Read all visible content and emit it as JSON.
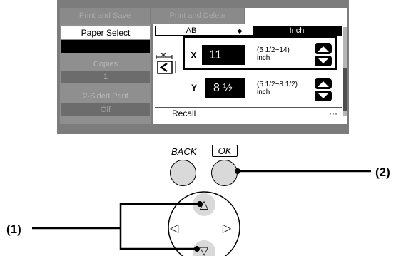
{
  "tabs": [
    "Print and Save",
    "Print and Delete",
    ""
  ],
  "left_panel": {
    "paper_select": "Paper Select",
    "copies_label": "Copies",
    "copies_value": "1",
    "duplex_label": "2-Sided Print",
    "duplex_value": "Off"
  },
  "unit_selector": {
    "ab": "AB",
    "arrows": "◆",
    "inch": "Inch"
  },
  "size_fields": {
    "x": {
      "label": "X",
      "value": "11",
      "range": "(5 1/2~14)",
      "unit": "inch"
    },
    "y": {
      "label": "Y",
      "value": "8 ½",
      "range": "(5 1/2~8 1/2)",
      "unit": "inch"
    }
  },
  "recall": {
    "label": "Recall",
    "more": "···"
  },
  "keys": {
    "back": "BACK",
    "ok": "OK"
  },
  "dpad": {
    "up": "△",
    "left": "◁",
    "right": "▷",
    "down": "▽"
  },
  "callouts": {
    "one": "(1)",
    "two": "(2)"
  },
  "colors": {
    "panel": "#7c7c7c",
    "key_fill": "#d9d9d9",
    "screen_bg": "#ffffff",
    "selected": "#000000"
  }
}
